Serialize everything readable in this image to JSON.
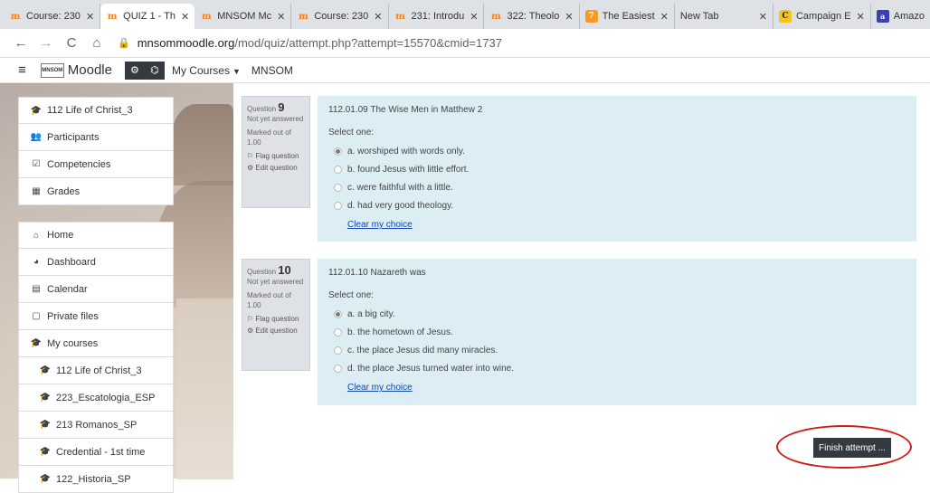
{
  "browser": {
    "tabs": [
      {
        "title": "Course: 230",
        "favicon": "moodle"
      },
      {
        "title": "QUIZ 1 - Th",
        "favicon": "moodle"
      },
      {
        "title": "MNSOM Mc",
        "favicon": "moodle"
      },
      {
        "title": "Course: 230",
        "favicon": "moodle"
      },
      {
        "title": "231: Introdu",
        "favicon": "moodle"
      },
      {
        "title": "322: Theolo",
        "favicon": "moodle"
      },
      {
        "title": "The Easiest",
        "favicon": "orange"
      },
      {
        "title": "New Tab",
        "favicon": "none"
      },
      {
        "title": "Campaign E",
        "favicon": "yellow"
      },
      {
        "title": "Amazo",
        "favicon": "blue"
      }
    ],
    "url_domain": "mnsommoodle.org",
    "url_path": "/mod/quiz/attempt.php?attempt=15570&cmid=1737"
  },
  "navbar": {
    "brand": "Moodle",
    "logo_text": "MNSOM",
    "my_courses": "My Courses",
    "site": "MNSOM"
  },
  "drawer": {
    "course_items": [
      {
        "label": "112 Life of Christ_3",
        "icon": "mortarboard-icon"
      },
      {
        "label": "Participants",
        "icon": "users-icon"
      },
      {
        "label": "Competencies",
        "icon": "checkbox-icon"
      },
      {
        "label": "Grades",
        "icon": "table-icon"
      }
    ],
    "nav_items": [
      {
        "label": "Home",
        "icon": "home-icon"
      },
      {
        "label": "Dashboard",
        "icon": "dashboard-icon"
      },
      {
        "label": "Calendar",
        "icon": "calendar-icon"
      },
      {
        "label": "Private files",
        "icon": "file-icon"
      },
      {
        "label": "My courses",
        "icon": "mortarboard-icon"
      },
      {
        "label": "112 Life of Christ_3",
        "icon": "mortarboard-icon"
      },
      {
        "label": "223_Escatologia_ESP",
        "icon": "mortarboard-icon"
      },
      {
        "label": "213 Romanos_SP",
        "icon": "mortarboard-icon"
      },
      {
        "label": "Credential - 1st time",
        "icon": "mortarboard-icon"
      },
      {
        "label": "122_Historia_SP",
        "icon": "mortarboard-icon"
      }
    ]
  },
  "questions": [
    {
      "label": "Question",
      "number": "9",
      "status": "Not yet answered",
      "marked": "Marked out of 1.00",
      "flag": "Flag question",
      "edit": "Edit question",
      "text": "112.01.09 The Wise Men in Matthew 2",
      "select_one": "Select one:",
      "options": [
        "a. worshiped with words only.",
        "b. found Jesus with little effort.",
        "c. were faithful with a little.",
        "d. had very good theology."
      ],
      "selected": 0,
      "clear": "Clear my choice"
    },
    {
      "label": "Question",
      "number": "10",
      "status": "Not yet answered",
      "marked": "Marked out of 1.00",
      "flag": "Flag question",
      "edit": "Edit question",
      "text": "112.01.10 Nazareth was",
      "select_one": "Select one:",
      "options": [
        "a. a big city.",
        "b. the hometown of Jesus.",
        "c. the place Jesus did many miracles.",
        "d. the place Jesus turned water into wine."
      ],
      "selected": 0,
      "clear": "Clear my choice"
    }
  ],
  "finish_button": "Finish attempt ...",
  "colors": {
    "accent_ring": "#d11a1a",
    "question_bg": "#dcedf4",
    "info_bg": "#dee2e6",
    "link": "#0f47ad"
  }
}
